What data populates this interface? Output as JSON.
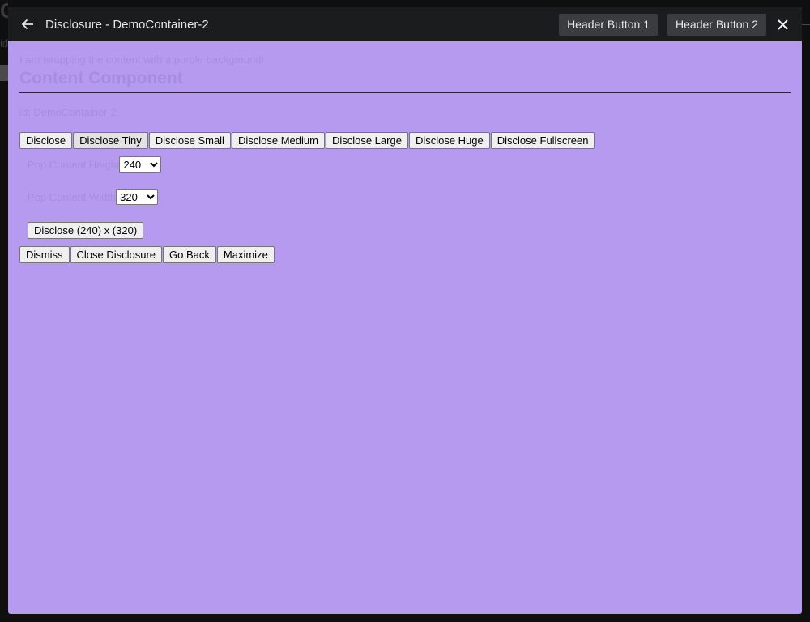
{
  "background_page": {
    "title": "Content Component",
    "id_text": "id"
  },
  "modal": {
    "title": "Disclosure - DemoContainer-2",
    "header_buttons": [
      "Header Button 1",
      "Header Button 2"
    ]
  },
  "content": {
    "wrap_note": "I am wrapping the content with a purple background!",
    "title": "Content Component",
    "id_line": "id: DemoContainer-2",
    "disclose_buttons": [
      "Disclose",
      "Disclose Tiny",
      "Disclose Small",
      "Disclose Medium",
      "Disclose Large",
      "Disclose Huge",
      "Disclose Fullscreen"
    ],
    "pop_height_label": "Pop Content Height",
    "pop_height_value": "240",
    "pop_width_label": "Pop Content Width",
    "pop_width_value": "320",
    "custom_disclose_label": "Disclose (240) x (320)",
    "action_buttons": [
      "Dismiss",
      "Close Disclosure",
      "Go Back",
      "Maximize"
    ]
  },
  "colors": {
    "modal_background": "#b69af0",
    "header_background": "#1b1c1e"
  }
}
